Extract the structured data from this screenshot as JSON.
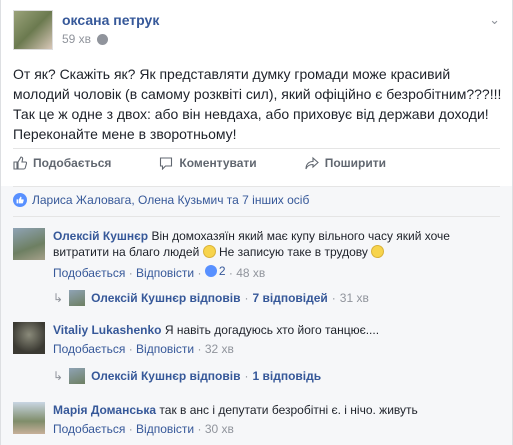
{
  "post": {
    "author": "оксана петрук",
    "time": "59 хв",
    "text": "От як? Скажіть як? Як представляти думку громади може красивий молодий чоловік (в самому розквіті сил), який офіційно є безробітним???!!! Так це ж одне з двох: або він невдаха, або приховує від держави доходи! Переконайте мене в зворотньому!"
  },
  "actions": {
    "like": "Подобається",
    "comment": "Коментувати",
    "share": "Поширити"
  },
  "likes_summary": "Лариса Жаловага, Олена Кузьмич та 7 інших осіб",
  "comments": [
    {
      "author": "Олексій Кушнєр",
      "text": "Він домохазяїн який має купу вільного часу який хоче витратити на благо людей",
      "text2": "Не записую таке в трудову",
      "like": "Подобається",
      "reply": "Відповісти",
      "likes": "2",
      "time": "48 хв",
      "replies": {
        "name": "Олексій Кушнєр відповів",
        "count": "7 відповідей",
        "time": "31 хв"
      }
    },
    {
      "author": "Vitaliy Lukashenko",
      "text": "Я навіть догадуюсь хто його танцює....",
      "like": "Подобається",
      "reply": "Відповісти",
      "time": "32 хв",
      "replies": {
        "name": "Олексій Кушнєр відповів",
        "count": "1 відповідь"
      }
    },
    {
      "author": "Марія Доманська",
      "text": "так в анс і депутати безробітні є. і нічо. живуть",
      "like": "Подобається",
      "reply": "Відповісти",
      "time": "30 хв"
    }
  ],
  "sep": "·"
}
